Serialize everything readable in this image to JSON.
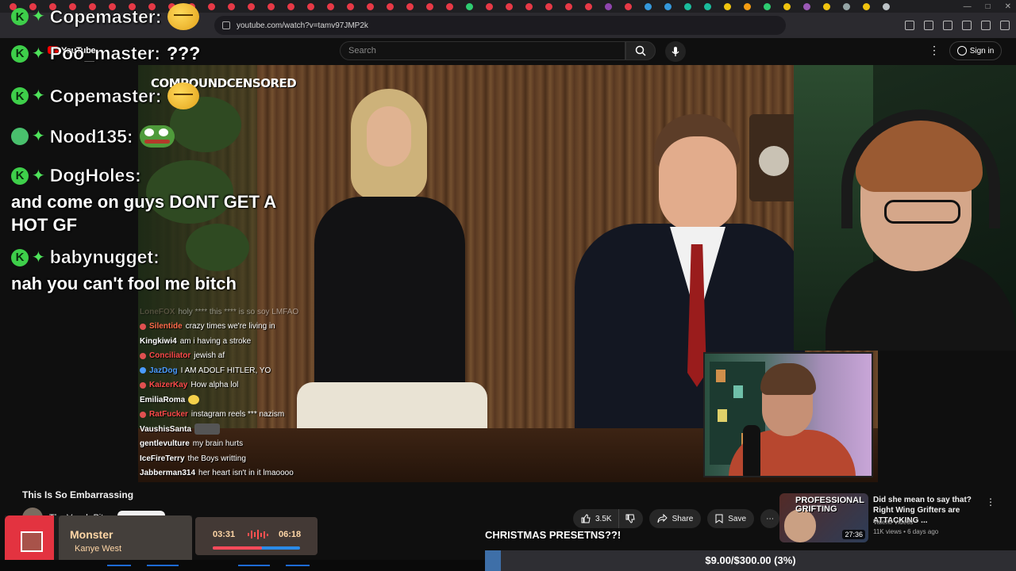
{
  "browser": {
    "url": "youtube.com/watch?v=tamv97JMP2k",
    "tab_colors": [
      "#e63946",
      "#e63946",
      "#e63946",
      "#e63946",
      "#e63946",
      "#e63946",
      "#e63946",
      "#e63946",
      "#e63946",
      "#e63946",
      "#e63946",
      "#e63946",
      "#e63946",
      "#e63946",
      "#e63946",
      "#e63946",
      "#e63946",
      "#e63946",
      "#e63946",
      "#e63946",
      "#e63946",
      "#e63946",
      "#e63946",
      "#2ecc71",
      "#e63946",
      "#e63946",
      "#e63946",
      "#e63946",
      "#e63946",
      "#e63946",
      "#8e44ad",
      "#e63946",
      "#3498db",
      "#3498db",
      "#1abc9c",
      "#1abc9c",
      "#f1c40f",
      "#f39c12",
      "#2ecc71",
      "#f1c40f",
      "#9b59b6",
      "#f1c40f",
      "#95a5a6",
      "#f1c40f",
      "#bdc3c7"
    ]
  },
  "youtube": {
    "logo": "YouTube",
    "search_placeholder": "Search",
    "sign_in": "Sign in"
  },
  "video_overlay": {
    "brand": "COMPOUNDCENSORED"
  },
  "big_chat": [
    {
      "name": "Copemaster:",
      "message": "",
      "emote": "relieved-face"
    },
    {
      "name": "Poo_master:",
      "message": "???",
      "emote": ""
    },
    {
      "name": "Copemaster:",
      "message": "",
      "emote": "relieved-face"
    },
    {
      "name": "Nood135:",
      "message": "",
      "emote": "pepe"
    },
    {
      "name": "DogHoles:",
      "message": "",
      "emote": ""
    },
    {
      "name": "babynugget:",
      "message": "",
      "emote": ""
    }
  ],
  "big_chat_text": {
    "doghole_line1": "and come on guys DONT GET A",
    "doghole_line2": "HOT GF",
    "babynugget_line": "nah you can't fool me bitch"
  },
  "small_chat": [
    {
      "name": "LoneFOX",
      "message": "holy **** this **** is so soy LMFAO",
      "color": "#8a7a6a",
      "badge": ""
    },
    {
      "name": "Silentide",
      "message": "crazy times we're living in",
      "color": "#ff6b4a",
      "badge": "#e05050"
    },
    {
      "name": "Kingkiwi4",
      "message": "am i having a stroke",
      "color": "#ffffff",
      "badge": ""
    },
    {
      "name": "Conciliator",
      "message": "jewish af",
      "color": "#ff4a4a",
      "badge": "#e05050"
    },
    {
      "name": "JazDog",
      "message": "I AM ADOLF HITLER, YO",
      "color": "#4a9bff",
      "badge": "#4a9bff"
    },
    {
      "name": "KaizerKay",
      "message": "How alpha lol",
      "color": "#ff4a4a",
      "badge": "#e05050"
    },
    {
      "name": "EmiliaRoma",
      "message": "",
      "color": "#ffffff",
      "badge": ""
    },
    {
      "name": "RatFucker",
      "message": "instagram reels *** nazism",
      "color": "#ff4a4a",
      "badge": "#e05050"
    },
    {
      "name": "VaushisSanta",
      "message": "",
      "color": "#ffffff",
      "badge": ""
    },
    {
      "name": "gentlevulture",
      "message": "my brain hurts",
      "color": "#ffffff",
      "badge": ""
    },
    {
      "name": "IceFireTerry",
      "message": "the Boys writting",
      "color": "#ffffff",
      "badge": ""
    },
    {
      "name": "Jabberman314",
      "message": "her heart isn't in it lmaoooo",
      "color": "#ffffff",
      "badge": ""
    }
  ],
  "video_info": {
    "title": "This Is So Embarrassing",
    "channel": "The Vaush Pit"
  },
  "actions": {
    "like_count": "3.5K",
    "share": "Share",
    "save": "Save"
  },
  "recommendation": {
    "thumb_text_1": "PROFESSIONAL",
    "thumb_text_2": "GRIFTING",
    "duration": "27:36",
    "title": "Did she mean to say that? Right Wing Grifters are ATTACKING ...",
    "channel": "Valenti Videos",
    "meta": "11K views • 6 days ago"
  },
  "now_playing": {
    "song": "Monster",
    "artist": "Kanye West",
    "elapsed": "03:31",
    "total": "06:18",
    "progress": 0.56
  },
  "stream_overlay": {
    "caption": "CHRISTMAS PRESETNS??!",
    "goal_text": "$9.00/$300.00 (3%)",
    "goal_progress": 0.03
  }
}
